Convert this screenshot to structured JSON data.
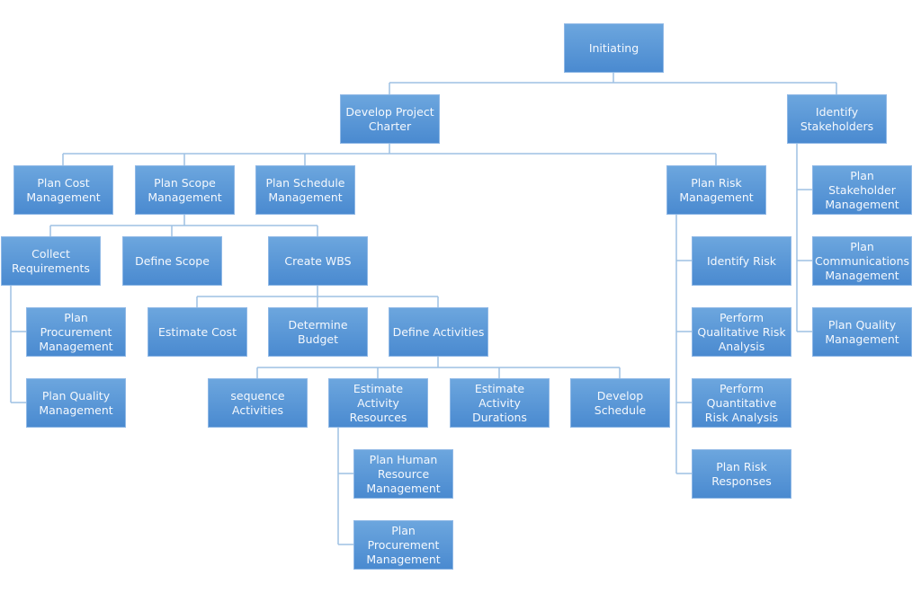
{
  "colors": {
    "box_fill_top": "#6ca6de",
    "box_fill_bottom": "#4a8ad0",
    "connector": "#9ec1e4",
    "text": "#f4f8fd"
  },
  "nodes": {
    "initiating": "Initiating",
    "develop_project_charter": "Develop Project Charter",
    "identify_stakeholders": "Identify Stakeholders",
    "plan_cost_management": "Plan Cost Management",
    "plan_scope_management": "Plan Scope Management",
    "plan_schedule_management": "Plan Schedule Management",
    "plan_risk_management": "Plan Risk Management",
    "plan_stakeholder_management": "Plan Stakeholder Management",
    "collect_requirements": "Collect Requirements",
    "define_scope": "Define Scope",
    "create_wbs": "Create WBS",
    "identify_risk": "Identify Risk",
    "plan_communications_management": "Plan Communications Management",
    "plan_procurement_management_1": "Plan Procurement Management",
    "estimate_cost": "Estimate Cost",
    "determine_budget": "Determine Budget",
    "define_activities": "Define Activities",
    "perform_qualitative_risk_analysis": "Perform Qualitative Risk Analysis",
    "plan_quality_management_2": "Plan Quality Management",
    "plan_quality_management_1": "Plan Quality Management",
    "sequence_activities": "sequence Activities",
    "estimate_activity_resources": "Estimate Activity Resources",
    "estimate_activity_durations": "Estimate Activity Durations",
    "develop_schedule": "Develop Schedule",
    "perform_quantitative_risk_analysis": "Perform Quantitative Risk Analysis",
    "plan_human_resource_management": "Plan Human Resource Management",
    "plan_risk_responses": "Plan Risk Responses",
    "plan_procurement_management_2": "Plan Procurement Management"
  }
}
